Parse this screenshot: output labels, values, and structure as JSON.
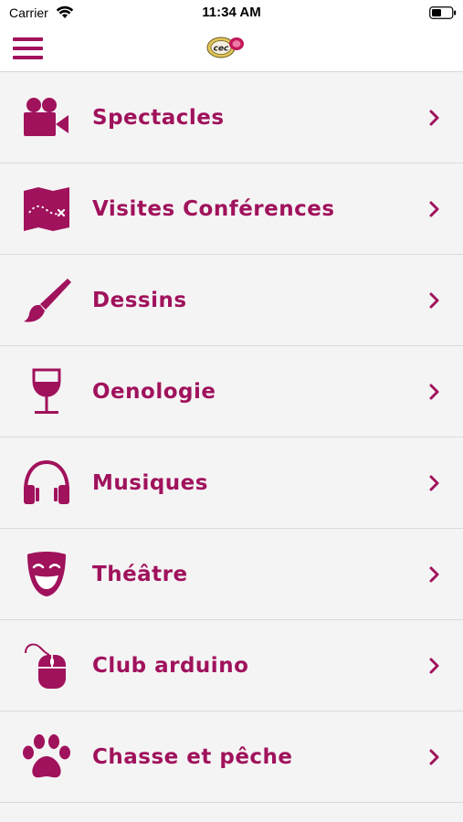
{
  "status_bar": {
    "carrier": "Carrier",
    "time": "11:34 AM"
  },
  "header": {
    "menu_icon": "hamburger-menu-icon",
    "logo": "cec-logo"
  },
  "theme": {
    "accent": "#a0125c",
    "background": "#f5f4f5",
    "divider": "#dcd9db"
  },
  "menu": {
    "items": [
      {
        "label": "Spectacles",
        "icon": "movie-camera-icon"
      },
      {
        "label": "Visites Conférences",
        "icon": "treasure-map-icon"
      },
      {
        "label": "Dessins",
        "icon": "paintbrush-icon"
      },
      {
        "label": "Oenologie",
        "icon": "wine-glass-icon"
      },
      {
        "label": "Musiques",
        "icon": "headphones-icon"
      },
      {
        "label": "Théâtre",
        "icon": "theater-mask-icon"
      },
      {
        "label": "Club arduino",
        "icon": "computer-mouse-icon"
      },
      {
        "label": "Chasse et pêche",
        "icon": "paw-print-icon"
      }
    ]
  }
}
